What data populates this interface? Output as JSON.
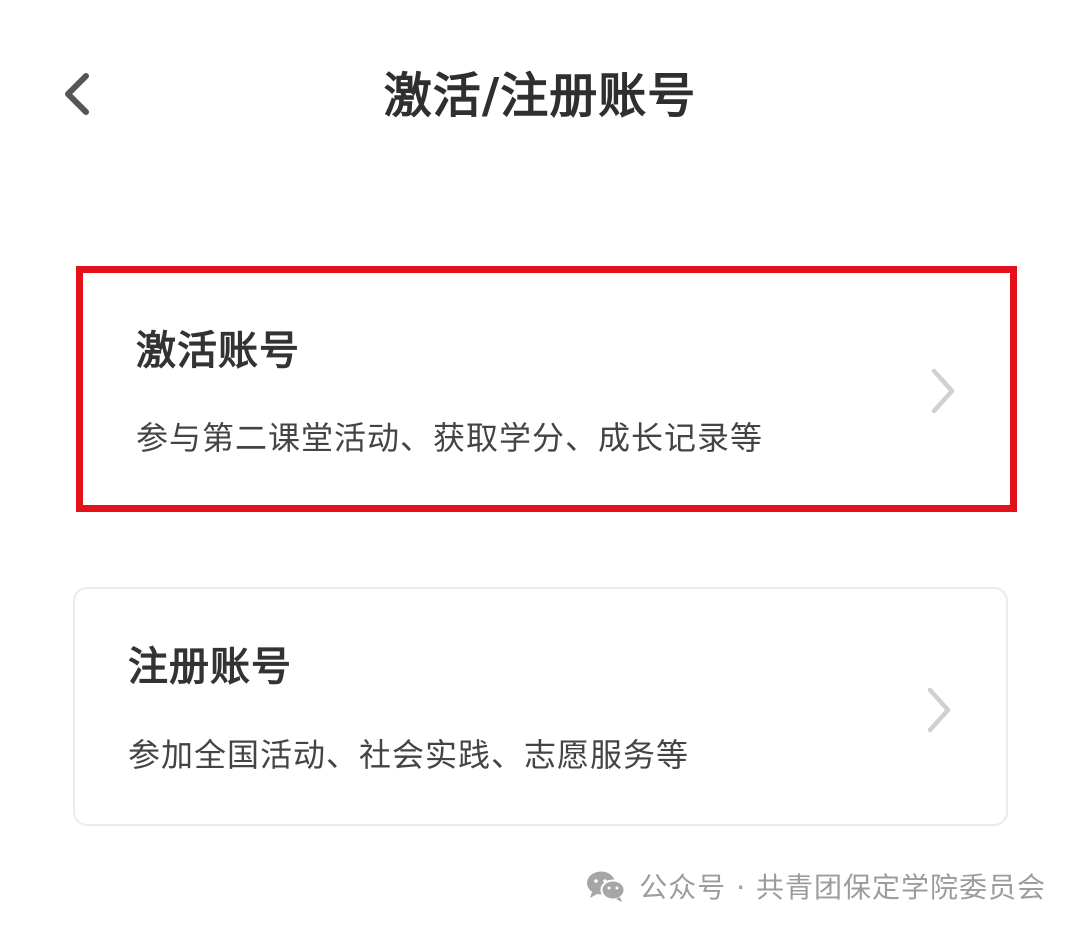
{
  "header": {
    "title": "激活/注册账号",
    "back_icon": "chevron-left-icon"
  },
  "options": [
    {
      "title": "激活账号",
      "description": "参与第二课堂活动、获取学分、成长记录等",
      "highlighted": true,
      "highlight_color": "#e3121a",
      "chevron_icon": "chevron-right-icon"
    },
    {
      "title": "注册账号",
      "description": "参加全国活动、社会实践、志愿服务等",
      "highlighted": false,
      "chevron_icon": "chevron-right-icon"
    }
  ],
  "watermark": {
    "icon": "wechat-icon",
    "text": "公众号 · 共青团保定学院委员会"
  }
}
